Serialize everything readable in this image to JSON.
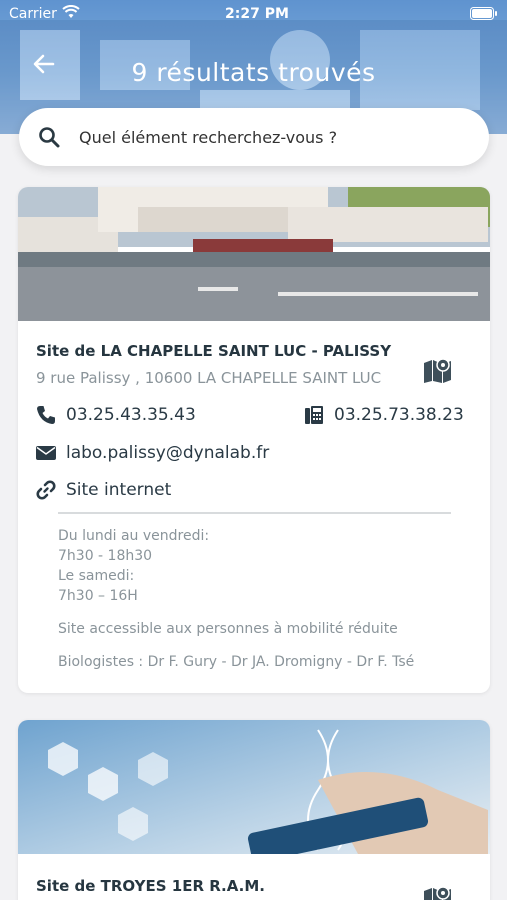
{
  "status_bar": {
    "carrier": "Carrier",
    "time": "2:27 PM"
  },
  "header": {
    "title": "9 résultats trouvés"
  },
  "search": {
    "placeholder": "Quel élément recherchez-vous ?"
  },
  "results": [
    {
      "name": "Site de LA CHAPELLE SAINT LUC - PALISSY",
      "address": "9 rue Palissy , 10600 LA CHAPELLE SAINT LUC",
      "phone": "03.25.43.35.43",
      "fax": "03.25.73.38.23",
      "email": "labo.palissy@dynalab.fr",
      "website_label": "Site internet",
      "hours_line1": "Du lundi au vendredi:",
      "hours_line2": "7h30 - 18h30",
      "hours_line3": "Le samedi:",
      "hours_line4": "7h30 – 16H",
      "accessibility": "Site accessible aux personnes à mobilité réduite",
      "biologists": "Biologistes : Dr F. Gury - Dr JA. Dromigny - Dr F. Tsé"
    },
    {
      "name": "Site de TROYES 1ER R.A.M."
    }
  ],
  "colors": {
    "header_blue": "#6a9dd4",
    "text_dark": "#263640",
    "text_muted": "#8a949a",
    "background": "#f2f2f4"
  }
}
